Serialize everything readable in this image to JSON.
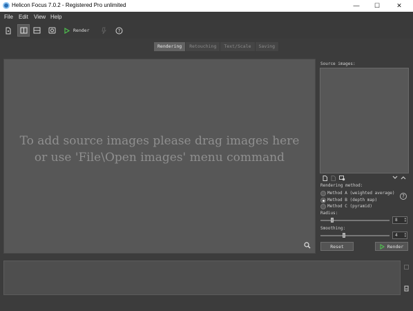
{
  "window": {
    "title": "Helicon Focus 7.0.2 - Registered Pro unlimited",
    "controls": {
      "minimize": "—",
      "maximize": "☐",
      "close": "✕"
    }
  },
  "menu": [
    "File",
    "Edit",
    "View",
    "Help"
  ],
  "toolbar": {
    "render_label": "Render",
    "icons": [
      "new-file-icon",
      "layout-columns-icon",
      "layout-rows-icon",
      "photo-icon",
      "render-play-icon",
      "pin-icon",
      "help-icon"
    ]
  },
  "tabs": [
    {
      "label": "Rendering",
      "active": true
    },
    {
      "label": "Retouching",
      "active": false
    },
    {
      "label": "Text/Scale",
      "active": false
    },
    {
      "label": "Saving",
      "active": false
    }
  ],
  "canvas": {
    "message": "To add source images please drag images here or use 'File\\Open images' menu command"
  },
  "side": {
    "source_label": "Source images:",
    "method_label": "Rendering method:",
    "methods": [
      {
        "label": "Method A (weighted average)",
        "checked": false
      },
      {
        "label": "Method B (depth map)",
        "checked": true
      },
      {
        "label": "Method C (pyramid)",
        "checked": false
      }
    ],
    "help_symbol": "?",
    "radius": {
      "label": "Radius:",
      "value": "8"
    },
    "smoothing": {
      "label": "Smoothing:",
      "value": "4"
    },
    "reset_label": "Reset",
    "render_label": "Render"
  },
  "colors": {
    "accent_green": "#4fbf4f",
    "background": "#3c3c3c",
    "canvas": "#575757"
  }
}
